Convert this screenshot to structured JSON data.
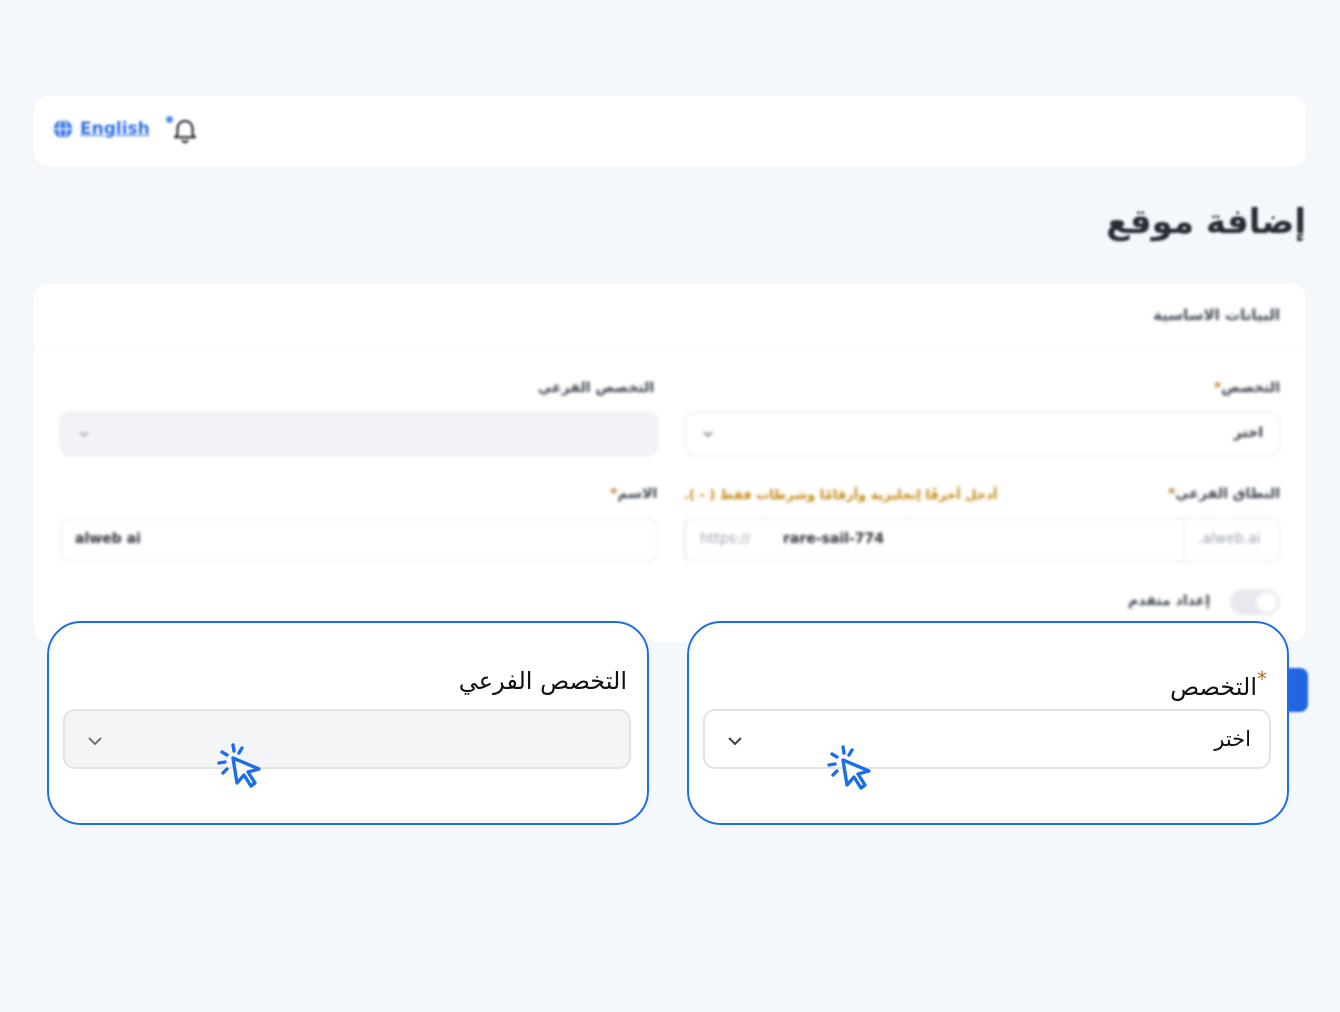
{
  "topbar": {
    "language_label": "English"
  },
  "page": {
    "title": "إضافة موقع"
  },
  "basic_info": {
    "header": "البيانات الاساسية",
    "specialty": {
      "label": "التخصص",
      "required_mark": "*",
      "value": "اختر"
    },
    "sub_specialty": {
      "label": "التخصص الفرعي",
      "value": ""
    },
    "subdomain": {
      "label": "النطاق الفرعي",
      "required_mark": "*",
      "hint": "أدخل أحرفًا إنجليزية وأرقامًا وشرطات فقط ( - ).",
      "prefix": "https://",
      "value": "rare-sail-774",
      "suffix": ".alweb.ai"
    },
    "name": {
      "label": "الاسم",
      "required_mark": "*",
      "value": "alweb ai"
    },
    "advanced": {
      "label": "إعداد متقدم",
      "enabled": false
    }
  },
  "callouts": {
    "specialty": {
      "label": "التخصص",
      "required_mark": "*",
      "value": "اختر"
    },
    "sub_specialty": {
      "label": "التخصص الفرعي",
      "value": ""
    }
  },
  "colors": {
    "accent": "#1e6ee8",
    "required": "#b7792b",
    "hint": "#c2860c",
    "background": "#f4f7fc"
  },
  "icons": [
    "globe-icon",
    "bell-icon",
    "chevron-down-icon",
    "click-cursor-icon"
  ]
}
